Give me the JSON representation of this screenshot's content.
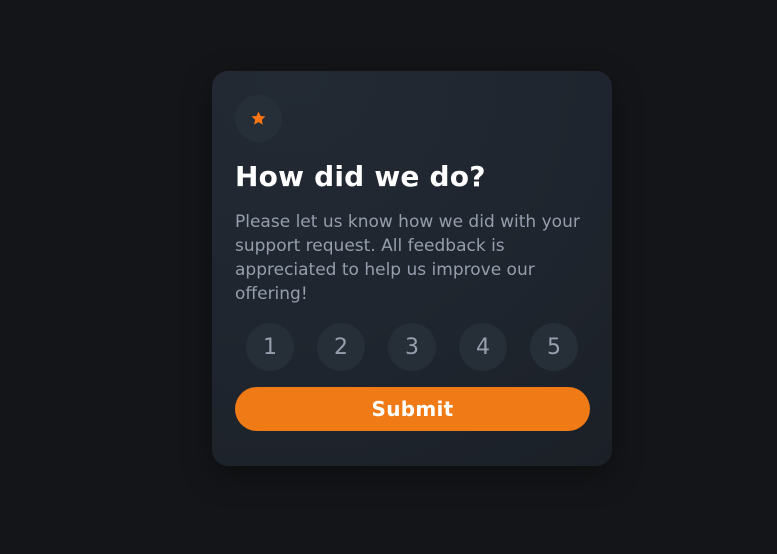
{
  "card": {
    "icon": "star-icon",
    "title": "How did we do?",
    "description": "Please let us know how we did with your support request. All feedback is appreciated to help us improve our offering!",
    "ratings": [
      "1",
      "2",
      "3",
      "4",
      "5"
    ],
    "submit_label": "Submit"
  },
  "colors": {
    "background": "#131518",
    "card": "#1f252e",
    "accent": "#f07a15",
    "muted_text": "#959eac",
    "circle": "#262e38",
    "heading": "#ffffff"
  }
}
